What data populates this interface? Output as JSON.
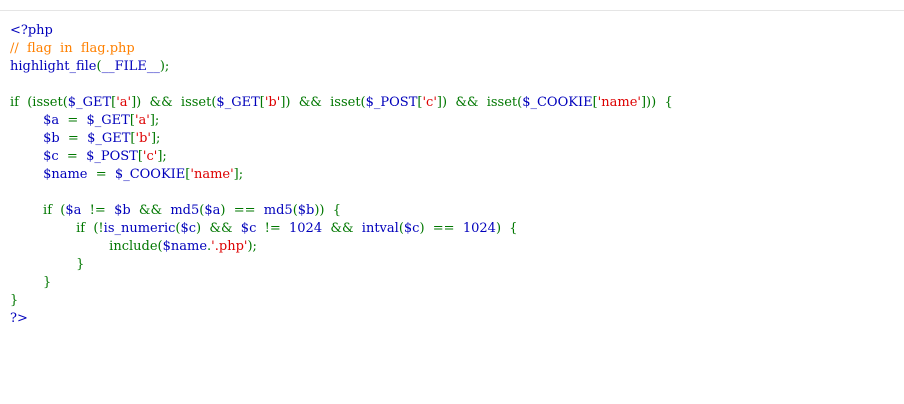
{
  "code_lines": [
    [
      {
        "t": "<?php",
        "c": "df"
      }
    ],
    [
      {
        "t": "//  flag  in  flag.php",
        "c": "cm"
      }
    ],
    [
      {
        "t": "highlight_file",
        "c": "df"
      },
      {
        "t": "(",
        "c": "kw"
      },
      {
        "t": "__FILE__",
        "c": "df"
      },
      {
        "t": ");",
        "c": "kw"
      }
    ],
    [],
    [
      {
        "t": "if  (isset(",
        "c": "kw"
      },
      {
        "t": "$_GET",
        "c": "df"
      },
      {
        "t": "[",
        "c": "kw"
      },
      {
        "t": "'a'",
        "c": "st"
      },
      {
        "t": "])  &&  isset(",
        "c": "kw"
      },
      {
        "t": "$_GET",
        "c": "df"
      },
      {
        "t": "[",
        "c": "kw"
      },
      {
        "t": "'b'",
        "c": "st"
      },
      {
        "t": "])  &&  isset(",
        "c": "kw"
      },
      {
        "t": "$_POST",
        "c": "df"
      },
      {
        "t": "[",
        "c": "kw"
      },
      {
        "t": "'c'",
        "c": "st"
      },
      {
        "t": "])  &&  isset(",
        "c": "kw"
      },
      {
        "t": "$_COOKIE",
        "c": "df"
      },
      {
        "t": "[",
        "c": "kw"
      },
      {
        "t": "'name'",
        "c": "st"
      },
      {
        "t": "]))  {",
        "c": "kw"
      }
    ],
    [
      {
        "t": "        ",
        "c": "kw"
      },
      {
        "t": "$a  ",
        "c": "df"
      },
      {
        "t": "=  ",
        "c": "kw"
      },
      {
        "t": "$_GET",
        "c": "df"
      },
      {
        "t": "[",
        "c": "kw"
      },
      {
        "t": "'a'",
        "c": "st"
      },
      {
        "t": "];",
        "c": "kw"
      }
    ],
    [
      {
        "t": "        ",
        "c": "kw"
      },
      {
        "t": "$b  ",
        "c": "df"
      },
      {
        "t": "=  ",
        "c": "kw"
      },
      {
        "t": "$_GET",
        "c": "df"
      },
      {
        "t": "[",
        "c": "kw"
      },
      {
        "t": "'b'",
        "c": "st"
      },
      {
        "t": "];",
        "c": "kw"
      }
    ],
    [
      {
        "t": "        ",
        "c": "kw"
      },
      {
        "t": "$c  ",
        "c": "df"
      },
      {
        "t": "=  ",
        "c": "kw"
      },
      {
        "t": "$_POST",
        "c": "df"
      },
      {
        "t": "[",
        "c": "kw"
      },
      {
        "t": "'c'",
        "c": "st"
      },
      {
        "t": "];",
        "c": "kw"
      }
    ],
    [
      {
        "t": "        ",
        "c": "kw"
      },
      {
        "t": "$name  ",
        "c": "df"
      },
      {
        "t": "=  ",
        "c": "kw"
      },
      {
        "t": "$_COOKIE",
        "c": "df"
      },
      {
        "t": "[",
        "c": "kw"
      },
      {
        "t": "'name'",
        "c": "st"
      },
      {
        "t": "];",
        "c": "kw"
      }
    ],
    [],
    [
      {
        "t": "        if  (",
        "c": "kw"
      },
      {
        "t": "$a  ",
        "c": "df"
      },
      {
        "t": "!=  ",
        "c": "kw"
      },
      {
        "t": "$b  ",
        "c": "df"
      },
      {
        "t": "&&  ",
        "c": "kw"
      },
      {
        "t": "md5",
        "c": "df"
      },
      {
        "t": "(",
        "c": "kw"
      },
      {
        "t": "$a",
        "c": "df"
      },
      {
        "t": ")  ==  ",
        "c": "kw"
      },
      {
        "t": "md5",
        "c": "df"
      },
      {
        "t": "(",
        "c": "kw"
      },
      {
        "t": "$b",
        "c": "df"
      },
      {
        "t": "))  {",
        "c": "kw"
      }
    ],
    [
      {
        "t": "                if  (!",
        "c": "kw"
      },
      {
        "t": "is_numeric",
        "c": "df"
      },
      {
        "t": "(",
        "c": "kw"
      },
      {
        "t": "$c",
        "c": "df"
      },
      {
        "t": ")  &&  ",
        "c": "kw"
      },
      {
        "t": "$c  ",
        "c": "df"
      },
      {
        "t": "!=  ",
        "c": "kw"
      },
      {
        "t": "1024  ",
        "c": "df"
      },
      {
        "t": "&&  ",
        "c": "kw"
      },
      {
        "t": "intval",
        "c": "df"
      },
      {
        "t": "(",
        "c": "kw"
      },
      {
        "t": "$c",
        "c": "df"
      },
      {
        "t": ")  ==  ",
        "c": "kw"
      },
      {
        "t": "1024",
        "c": "df"
      },
      {
        "t": ")  {",
        "c": "kw"
      }
    ],
    [
      {
        "t": "                        include(",
        "c": "kw"
      },
      {
        "t": "$name",
        "c": "df"
      },
      {
        "t": ".",
        "c": "kw"
      },
      {
        "t": "'.php'",
        "c": "st"
      },
      {
        "t": ");",
        "c": "kw"
      }
    ],
    [
      {
        "t": "                }",
        "c": "kw"
      }
    ],
    [
      {
        "t": "        }",
        "c": "kw"
      }
    ],
    [
      {
        "t": "}",
        "c": "kw"
      }
    ],
    [
      {
        "t": "?>",
        "c": "df"
      }
    ]
  ],
  "colors": {
    "default": "#0000bb",
    "keyword": "#007700",
    "comment": "#ff8000",
    "string": "#dd0000",
    "background": "#ffffff"
  }
}
